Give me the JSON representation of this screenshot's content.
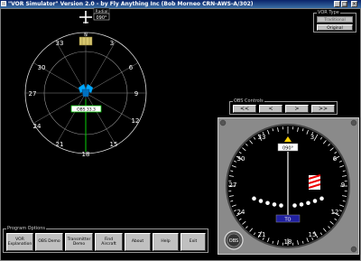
{
  "window": {
    "title": "\"VOR Simulator\" Version 2.0 - by Fly Anything Inc (Bob Morneo CRN-AWS-A/302)"
  },
  "vor_display": {
    "radial_label": "Radial",
    "radial_value": "090°",
    "compass_labels": [
      "33",
      "3",
      "6",
      "30",
      "9",
      "27",
      "12",
      "24",
      "15",
      "21",
      "18",
      "N"
    ],
    "obs_readout": "OBS  33.3"
  },
  "vor_type": {
    "title": "VOR Type",
    "options": [
      "Traditional",
      "Original"
    ],
    "selected": "Original"
  },
  "obs_controls": {
    "title": "OBS Controls",
    "buttons": [
      "<<",
      "<",
      ">",
      ">>"
    ]
  },
  "instrument": {
    "course": "090°",
    "labels": [
      "33",
      "3",
      "30",
      "6",
      "27",
      "9",
      "24",
      "12",
      "21",
      "15",
      "18"
    ],
    "obs_knob": "OBS",
    "to_from": "TO"
  },
  "program_options": {
    "title": "Program Options",
    "buttons": [
      "VOR\nExplanation",
      "OBS Demo",
      "Transmitter\nDemo",
      "Find\nAircraft",
      "About",
      "Help",
      "Exit"
    ]
  },
  "colors": {
    "titlebar": "#0a246a",
    "ring": "#ffffff",
    "needle": "#00ff00",
    "aircraft": "#00a8ff",
    "tower": "#d8c870"
  }
}
